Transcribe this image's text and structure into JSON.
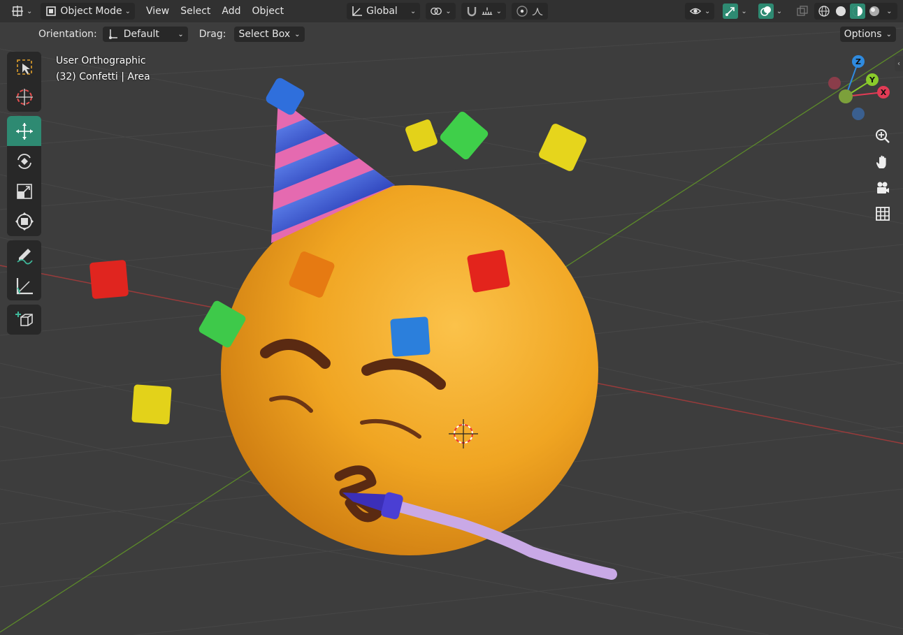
{
  "header": {
    "editor_type_icon": "crosshair-grid-icon",
    "mode_label": "Object Mode",
    "menus": [
      "View",
      "Select",
      "Add",
      "Object"
    ],
    "transform_orientation": "Global",
    "icons": [
      "pivot-icon",
      "snap-magnet-icon",
      "snap-increment-icon",
      "proportional-edit-icon",
      "falloff-curve-icon",
      "visibility-icon",
      "gizmo-icon",
      "overlay-icon",
      "xray-icon",
      "shading-wireframe-icon",
      "shading-solid-icon",
      "shading-material-icon",
      "shading-rendered-icon"
    ]
  },
  "tool_settings": {
    "orientation_label": "Orientation:",
    "orientation_value": "Default",
    "drag_label": "Drag:",
    "drag_value": "Select Box",
    "options_label": "Options"
  },
  "tools": [
    "select-box-icon",
    "cursor-icon",
    "move-icon",
    "rotate-icon",
    "scale-icon",
    "transform-icon",
    "annotate-icon",
    "measure-icon",
    "add-cube-icon"
  ],
  "active_tool": "move-icon",
  "viewport": {
    "view_name": "User Orthographic",
    "object_info": "(32) Confetti | Area"
  },
  "gizmo": {
    "axes": [
      "Z",
      "Y",
      "X"
    ],
    "colors": {
      "x": "#e23b55",
      "y": "#8acb2b",
      "z": "#2f8be0"
    }
  },
  "nav_buttons": [
    "zoom-icon",
    "pan-hand-icon",
    "camera-icon",
    "grid-icon"
  ],
  "colors": {
    "viewport_bg": "#3d3d3d",
    "active_tool": "#2e8a72",
    "emoji": "#f1a524"
  }
}
